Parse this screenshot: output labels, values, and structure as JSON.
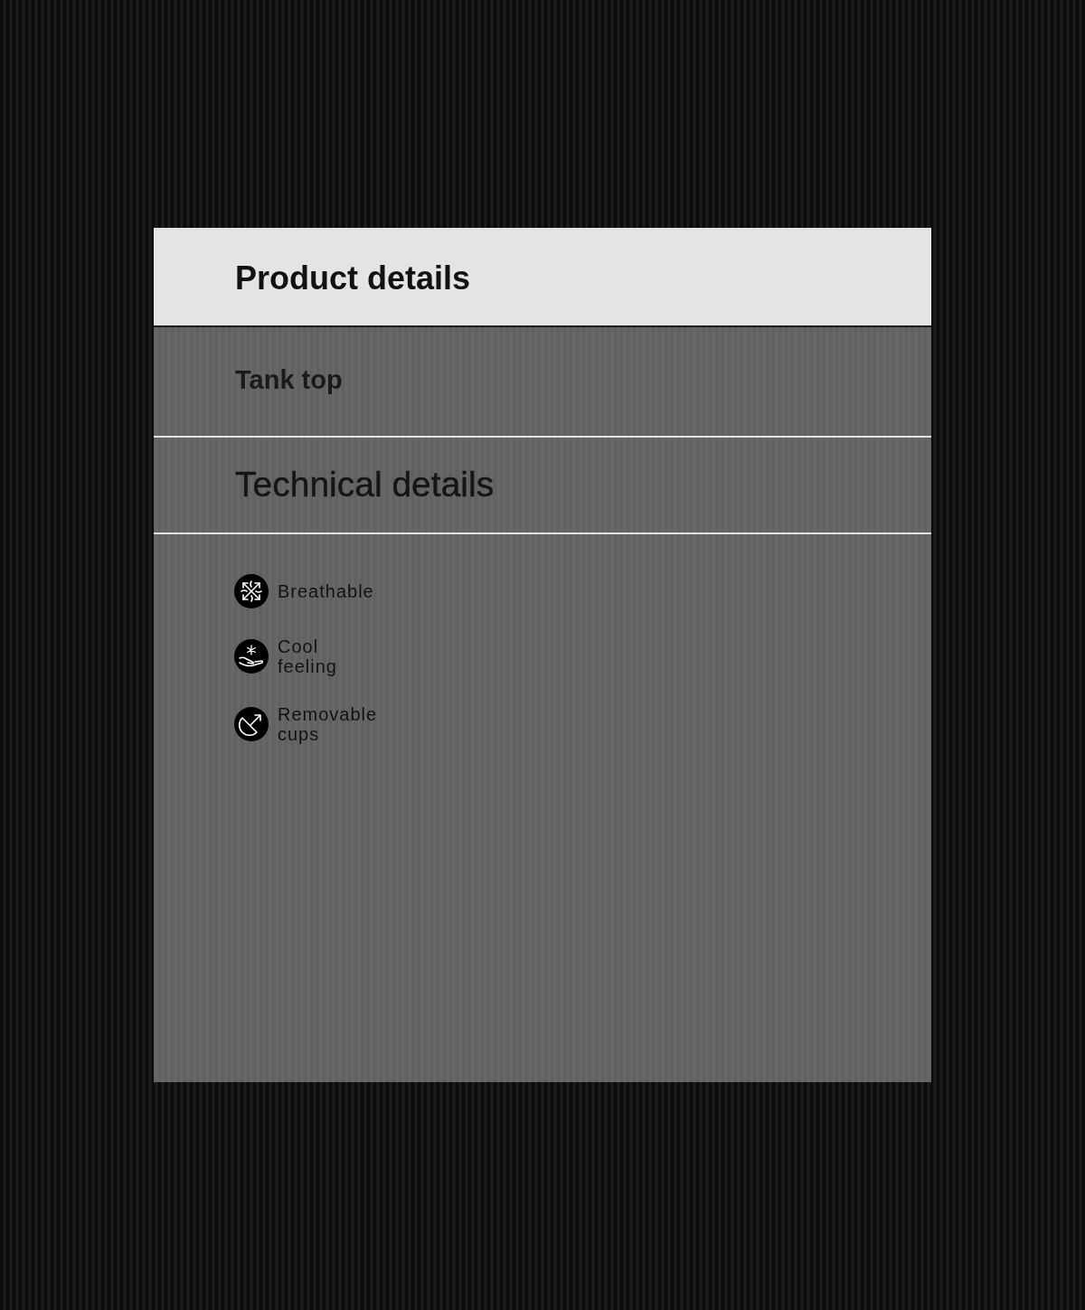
{
  "header": {
    "title": "Product details"
  },
  "product": {
    "name": "Tank top"
  },
  "technical": {
    "title": "Technical details",
    "features": [
      {
        "kind": "breathable",
        "label": "Breathable"
      },
      {
        "kind": "cool",
        "label": "Cool feeling"
      },
      {
        "kind": "cups",
        "label": "Removable cups"
      }
    ]
  }
}
